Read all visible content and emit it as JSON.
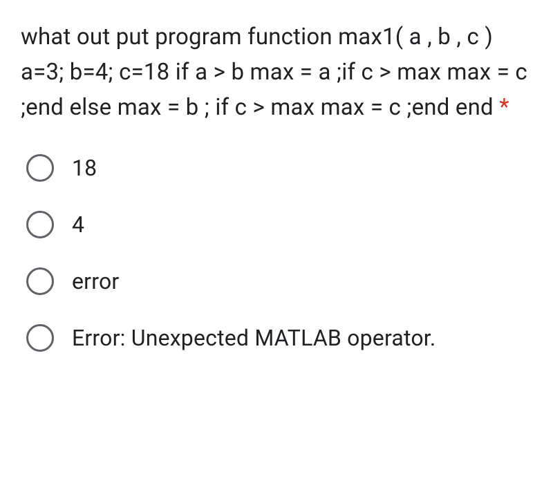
{
  "question": {
    "text": "what out put program function max1( a , b , c ) a=3; b=4; c=18 if a > b max = a ;if c > max max = c ;end else max = b ; if c > max max = c ;end end ",
    "required_marker": "*"
  },
  "options": [
    {
      "label": "18"
    },
    {
      "label": "4"
    },
    {
      "label": "error"
    },
    {
      "label": "Error: Unexpected MATLAB operator."
    }
  ]
}
